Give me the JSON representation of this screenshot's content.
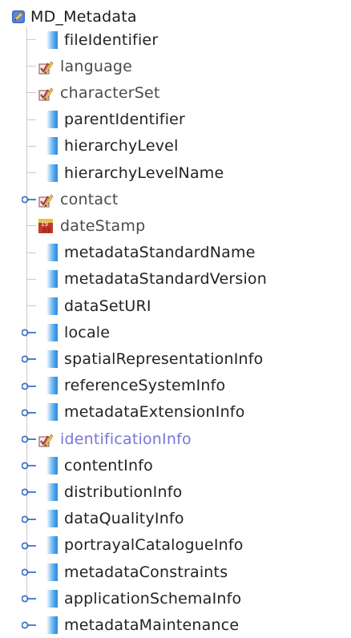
{
  "root": {
    "label": "MD_Metadata",
    "icon": "metadata-pencil-icon"
  },
  "items": [
    {
      "label": "fileIdentifier",
      "icon": "element-bar-icon",
      "expandable": false,
      "style": "normal"
    },
    {
      "label": "language",
      "icon": "checkbox-pencil-icon",
      "expandable": false,
      "style": "muted"
    },
    {
      "label": "characterSet",
      "icon": "checkbox-pencil-icon",
      "expandable": false,
      "style": "muted"
    },
    {
      "label": "parentIdentifier",
      "icon": "element-bar-icon",
      "expandable": false,
      "style": "normal"
    },
    {
      "label": "hierarchyLevel",
      "icon": "element-bar-icon",
      "expandable": false,
      "style": "normal"
    },
    {
      "label": "hierarchyLevelName",
      "icon": "element-bar-icon",
      "expandable": false,
      "style": "normal"
    },
    {
      "label": "contact",
      "icon": "checkbox-pencil-icon",
      "expandable": true,
      "style": "muted"
    },
    {
      "label": "dateStamp",
      "icon": "calendar-icon",
      "expandable": false,
      "style": "muted"
    },
    {
      "label": "metadataStandardName",
      "icon": "element-bar-icon",
      "expandable": false,
      "style": "normal"
    },
    {
      "label": "metadataStandardVersion",
      "icon": "element-bar-icon",
      "expandable": false,
      "style": "normal"
    },
    {
      "label": "dataSetURI",
      "icon": "element-bar-icon",
      "expandable": false,
      "style": "normal"
    },
    {
      "label": "locale",
      "icon": "element-bar-icon",
      "expandable": true,
      "style": "normal"
    },
    {
      "label": "spatialRepresentationInfo",
      "icon": "element-bar-icon",
      "expandable": true,
      "style": "normal"
    },
    {
      "label": "referenceSystemInfo",
      "icon": "element-bar-icon",
      "expandable": true,
      "style": "normal"
    },
    {
      "label": "metadataExtensionInfo",
      "icon": "element-bar-icon",
      "expandable": true,
      "style": "normal"
    },
    {
      "label": "identificationInfo",
      "icon": "checkbox-pencil-icon",
      "expandable": true,
      "style": "link"
    },
    {
      "label": "contentInfo",
      "icon": "element-bar-icon",
      "expandable": true,
      "style": "normal"
    },
    {
      "label": "distributionInfo",
      "icon": "element-bar-icon",
      "expandable": true,
      "style": "normal"
    },
    {
      "label": "dataQualityInfo",
      "icon": "element-bar-icon",
      "expandable": true,
      "style": "normal"
    },
    {
      "label": "portrayalCatalogueInfo",
      "icon": "element-bar-icon",
      "expandable": true,
      "style": "normal"
    },
    {
      "label": "metadataConstraints",
      "icon": "element-bar-icon",
      "expandable": true,
      "style": "normal"
    },
    {
      "label": "applicationSchemaInfo",
      "icon": "element-bar-icon",
      "expandable": true,
      "style": "normal"
    },
    {
      "label": "metadataMaintenance",
      "icon": "element-bar-icon",
      "expandable": true,
      "style": "normal"
    }
  ],
  "colors": {
    "guide": "#c9c9c9",
    "expander": "#3b74c8",
    "bar_blue": "#2b8bdc",
    "check_red": "#b03a3a",
    "link": "#7b74d8"
  }
}
